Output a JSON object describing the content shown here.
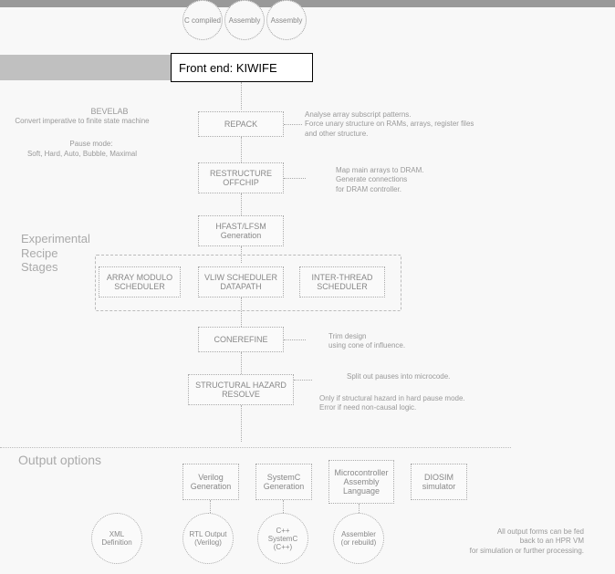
{
  "topbar": {},
  "inputs": {
    "a": "C compiled",
    "b": "Assembly",
    "c": "Assembly"
  },
  "frontend": {
    "title": "Front end: KIWIFE"
  },
  "bevelab": {
    "title": "BEVELAB",
    "subtitle": "Convert imperative to finite state machine",
    "pause_label": "Pause mode:",
    "pause_modes": "Soft, Hard, Auto, Bubble, Maximal"
  },
  "stages": {
    "repack": "REPACK",
    "restructure1": "RESTRUCTURE",
    "restructure2": "OFFCHIP",
    "hfastgen1": "HFAST/LFSM",
    "hfastgen2": "Generation",
    "vliw1": "VLIW SCHEDULER",
    "vliw2": "DATAPATH",
    "inter1": "INTER-THREAD",
    "inter2": "SCHEDULER",
    "array1": "ARRAY MODULO",
    "array2": "SCHEDULER",
    "conerefine": "CONEREFINE",
    "structural1": "STRUCTURAL HAZARD",
    "structural2": "RESOLVE",
    "verilog1": "Verilog",
    "verilog2": "Generation",
    "systemc1": "SystemC",
    "systemc2": "Generation",
    "micro1": "Microcontroller",
    "micro2": "Assembly",
    "micro3": "Language",
    "diosim1": "DIOSIM",
    "diosim2": "simulator"
  },
  "notes": {
    "repack1": "Analyse array subscript patterns.",
    "repack2": "Force unary structure on RAMs, arrays, register files",
    "repack3": "and other structure.",
    "restructure1": "Map main arrays to DRAM.",
    "restructure2": "Generate connections",
    "restructure3": "for DRAM controller.",
    "conerefine1": "Trim design",
    "conerefine2": "using cone of influence.",
    "structural1": "Split out pauses into microcode.",
    "structural2": "Only if structural hazard in hard pause mode.",
    "structural3": "Error if need non-causal logic.",
    "output1": "All output forms can be fed",
    "output2": "back to an HPR VM",
    "output3": "for simulation or further processing."
  },
  "labels": {
    "experimental1": "Experimental",
    "experimental2": "Recipe",
    "experimental3": "Stages",
    "output": "Output options"
  },
  "outputs": {
    "xml1": "XML",
    "xml2": "Definition",
    "rtl1": "RTL Output",
    "rtl2": "(Verilog)",
    "cxx1": "C++",
    "cxx2": "SystemC",
    "cxx3": "(C++)",
    "asm1": "Assembler",
    "asm2": "(or rebuild)"
  }
}
